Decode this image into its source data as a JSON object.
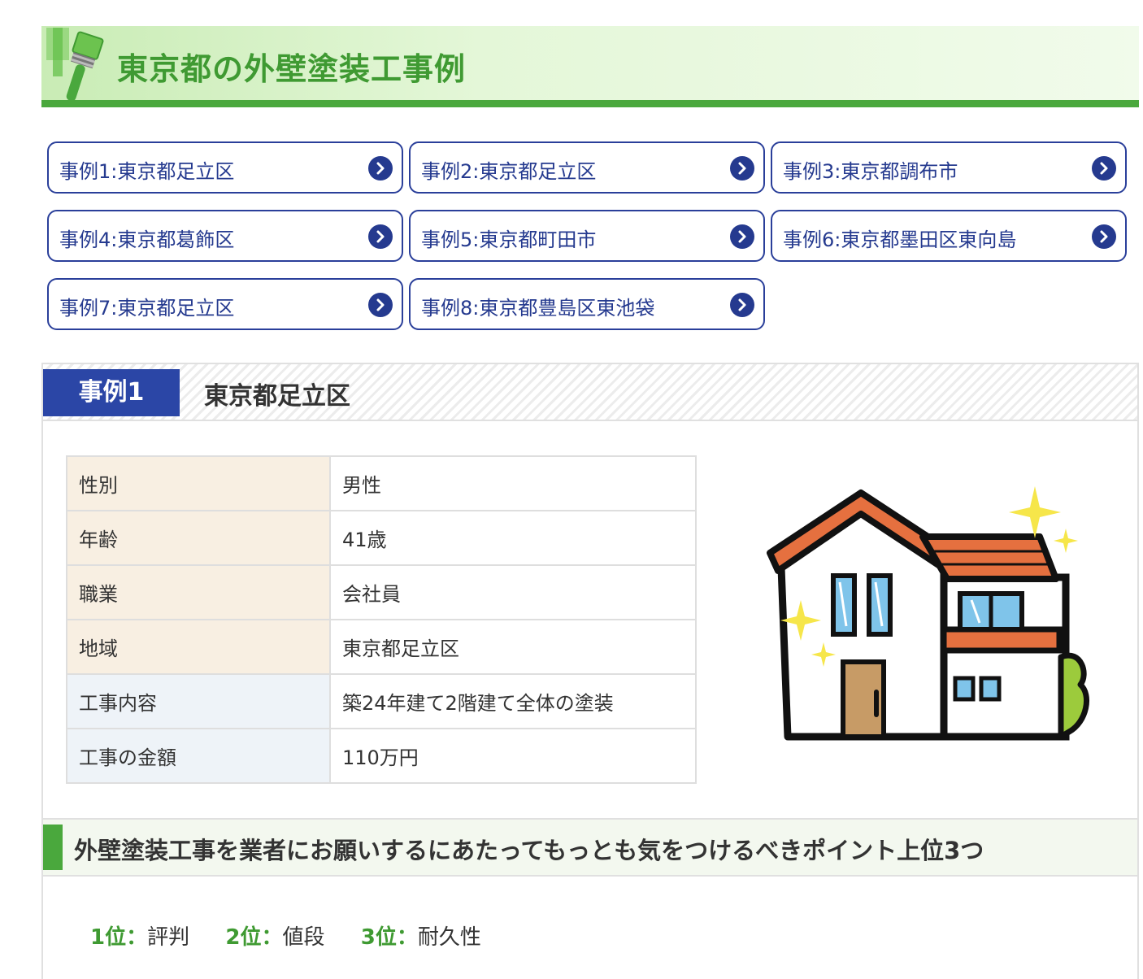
{
  "header": {
    "title": "東京都の外壁塗装工事例"
  },
  "links": [
    {
      "label": "事例1:東京都足立区"
    },
    {
      "label": "事例2:東京都足立区"
    },
    {
      "label": "事例3:東京都調布市"
    },
    {
      "label": "事例4:東京都葛飾区"
    },
    {
      "label": "事例5:東京都町田市"
    },
    {
      "label": "事例6:東京都墨田区東向島"
    },
    {
      "label": "事例7:東京都足立区"
    },
    {
      "label": "事例8:東京都豊島区東池袋"
    }
  ],
  "case": {
    "tag": "事例1",
    "title": "東京都足立区",
    "rows": [
      {
        "key": "性別",
        "value": "男性"
      },
      {
        "key": "年齢",
        "value": "41歳"
      },
      {
        "key": "職業",
        "value": "会社員"
      },
      {
        "key": "地域",
        "value": "東京都足立区"
      },
      {
        "key": "工事内容",
        "value": "築24年建て2階建て全体の塗装"
      },
      {
        "key": "工事の金額",
        "value": "110万円"
      }
    ]
  },
  "points": {
    "heading": "外壁塗装工事を業者にお願いするにあたってもっとも気をつけるべきポイント上位3つ",
    "ranks": [
      {
        "rank": "1位：",
        "value": "評判"
      },
      {
        "rank": "2位：",
        "value": "値段"
      },
      {
        "rank": "3位：",
        "value": "耐久性"
      }
    ]
  },
  "colors": {
    "green": "#4aa83d",
    "navy": "#253a8f",
    "tag_blue": "#2b46a6"
  },
  "icons": [
    "paint-brush-icon",
    "chevron-right-icon",
    "house-illustration"
  ]
}
